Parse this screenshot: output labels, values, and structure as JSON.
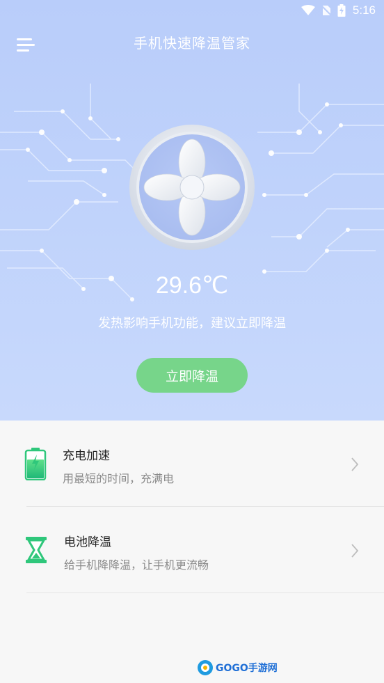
{
  "status_bar": {
    "time": "5:16"
  },
  "header": {
    "title": "手机快速降温管家"
  },
  "cooling": {
    "temperature": "29.6℃",
    "hint": "发热影响手机功能，建议立即降温",
    "button_label": "立即降温"
  },
  "features": [
    {
      "name": "充电加速",
      "desc": "用最短的时间，充满电",
      "icon": "battery-charging-icon"
    },
    {
      "name": "电池降温",
      "desc": "给手机降降温，让手机更流畅",
      "icon": "hourglass-icon"
    }
  ],
  "watermark": {
    "logo_text": "GOGO手游网"
  },
  "colors": {
    "hero_bg": "#bfd2fb",
    "accent_green": "#77d58a",
    "icon_green": "#2fc77b"
  }
}
